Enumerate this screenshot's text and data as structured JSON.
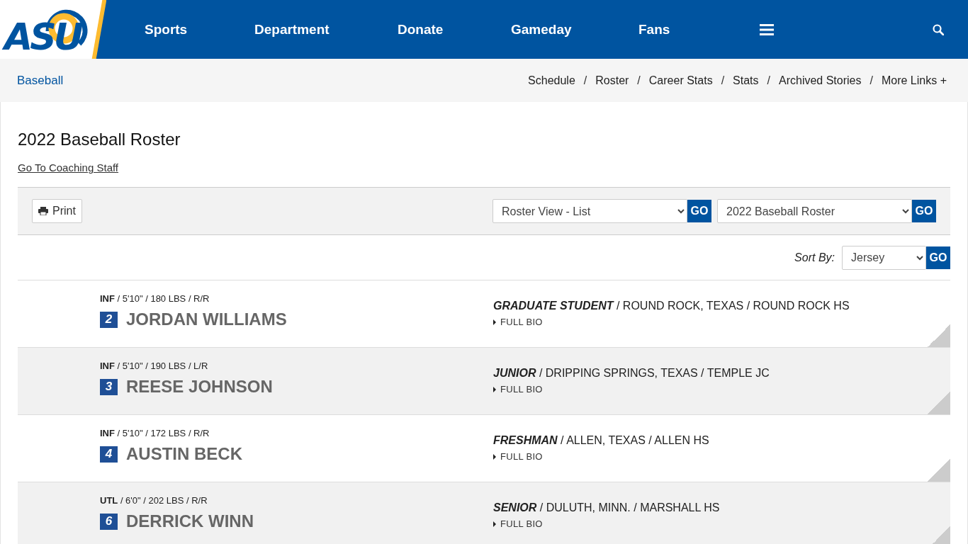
{
  "logo": {
    "text": "ASU"
  },
  "nav": {
    "items": [
      "Sports",
      "Department",
      "Donate",
      "Gameday",
      "Fans"
    ]
  },
  "subnav": {
    "sport": "Baseball",
    "links": [
      "Schedule",
      "Roster",
      "Career Stats",
      "Stats",
      "Archived Stories",
      "More Links +"
    ],
    "separator": "/"
  },
  "page": {
    "title": "2022 Baseball Roster",
    "coaching_link": "Go To Coaching Staff"
  },
  "toolbar": {
    "print": "Print",
    "view_select": "Roster View - List",
    "view_go": "GO",
    "season_select": "2022 Baseball Roster",
    "season_go": "GO"
  },
  "sort": {
    "label": "Sort By:",
    "value": "Jersey",
    "go": "GO"
  },
  "players": [
    {
      "meta": "**INF** / 5'10\" / 180 LBS / R/R",
      "number": "2",
      "name": "JORDAN WILLIAMS",
      "bio": "**GRADUATE STUDENT** / ROUND ROCK, TEXAS / ROUND ROCK HS",
      "link": "FULL BIO"
    },
    {
      "meta": "**INF** / 5'10\" / 190 LBS / L/R",
      "number": "3",
      "name": "REESE JOHNSON",
      "bio": "**JUNIOR** / DRIPPING SPRINGS, TEXAS / TEMPLE JC",
      "link": "FULL BIO"
    },
    {
      "meta": "**INF** / 5'10\" / 172 LBS / R/R",
      "number": "4",
      "name": "AUSTIN BECK",
      "bio": "**FRESHMAN** / ALLEN, TEXAS / ALLEN HS",
      "link": "FULL BIO"
    },
    {
      "meta": "**UTL** / 6'0\" / 202 LBS / R/R",
      "number": "6",
      "name": "DERRICK WINN",
      "bio": "**SENIOR** / DULUTH, MINN. / MARSHALL HS",
      "link": "FULL BIO"
    }
  ]
}
